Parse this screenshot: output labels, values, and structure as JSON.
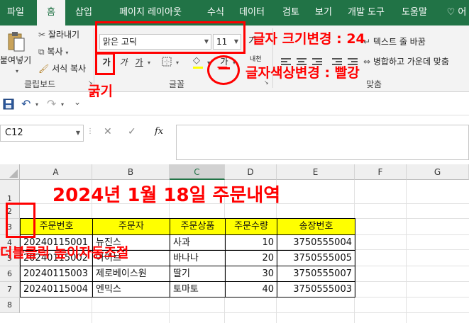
{
  "tabs": [
    "파일",
    "홈",
    "삽입",
    "페이지 레이아웃",
    "수식",
    "데이터",
    "검토",
    "보기",
    "개발 도구",
    "도움말",
    "어"
  ],
  "active_tab": "홈",
  "clipboard": {
    "paste_label": "붙여넣기",
    "cut_label": "잘라내기",
    "copy_label": "복사",
    "format_painter_label": "서식 복사",
    "group_label": "클립보드"
  },
  "font": {
    "name": "맑은 고딕",
    "size": "11",
    "bold_glyph": "가",
    "italic_glyph": "가",
    "underline_glyph": "가",
    "font_color_glyph": "가",
    "phonetic_label": "내천",
    "grow_glyph": "가",
    "shrink_glyph": "가",
    "group_label": "글꼴"
  },
  "alignment": {
    "wrap_label": "텍스트 줄 바꿈",
    "merge_label": "병합하고 가운데 맞춤",
    "group_label": "맞춤"
  },
  "formula_bar": {
    "cell_ref": "C12",
    "fx": "fx",
    "value": ""
  },
  "columns": [
    "A",
    "B",
    "C",
    "D",
    "E",
    "F",
    "G"
  ],
  "selected_column": "C",
  "rows": [
    "1",
    "2",
    "3",
    "4",
    "5",
    "6",
    "7",
    "8"
  ],
  "sheet": {
    "title": "2024년 1월 18일 주문내역",
    "headers": [
      "주문번호",
      "주문자",
      "주문상품",
      "주문수량",
      "송장번호"
    ],
    "data": [
      [
        "20240115001",
        "뉴진스",
        "사과",
        "10",
        "3750555004"
      ],
      [
        "20240115002",
        "아이브",
        "바나나",
        "20",
        "3750555005"
      ],
      [
        "20240115003",
        "제로베이스원",
        "딸기",
        "30",
        "3750555007"
      ],
      [
        "20240115004",
        "엔믹스",
        "토마토",
        "40",
        "3750555003"
      ]
    ]
  },
  "annotations": {
    "font_size": "글자 크기변경 : 24",
    "font_color": "글자색상변경 : 빨강",
    "bold": "굵기",
    "row_height": "더블클릭 높이자동조절",
    "circle_mark": "ㅡ"
  },
  "colors": {
    "ribbon_tab_bg": "#217346",
    "header_fill": "#ffff00",
    "annotation": "#ff0000",
    "title_text": "#ff0000"
  }
}
